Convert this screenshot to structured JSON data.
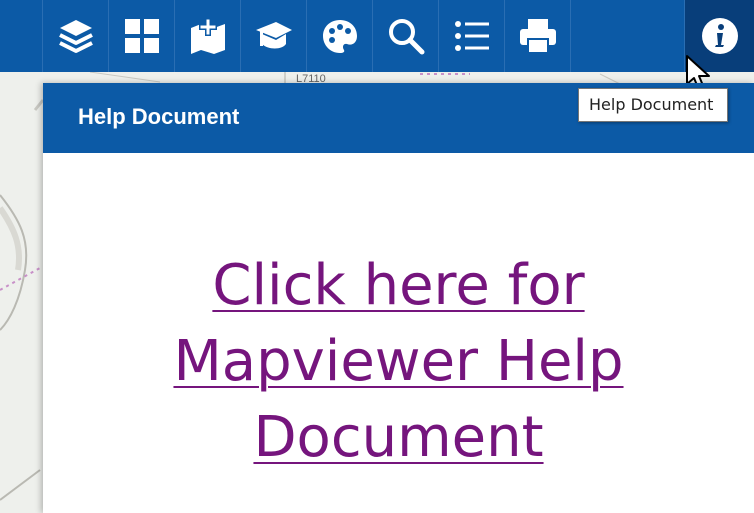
{
  "toolbar": {
    "buttons": [
      {
        "name": "layers-button",
        "icon": "layers-icon"
      },
      {
        "name": "basemap-gallery-button",
        "icon": "grid-icon"
      },
      {
        "name": "add-data-button",
        "icon": "map-plus-icon"
      },
      {
        "name": "education-button",
        "icon": "graduation-cap-icon"
      },
      {
        "name": "theme-button",
        "icon": "palette-icon"
      },
      {
        "name": "search-button",
        "icon": "search-icon"
      },
      {
        "name": "legend-button",
        "icon": "list-icon"
      },
      {
        "name": "print-button",
        "icon": "printer-icon"
      },
      {
        "name": "help-button",
        "icon": "info-icon",
        "active": true
      }
    ],
    "accent_color": "#0c5aa6"
  },
  "tooltip": {
    "text": "Help Document"
  },
  "panel": {
    "title": "Help Document",
    "link_lines": [
      "Click here for",
      "Mapviewer Help",
      "Document"
    ],
    "link_color": "#75157d"
  },
  "map": {
    "label": "L7110"
  }
}
